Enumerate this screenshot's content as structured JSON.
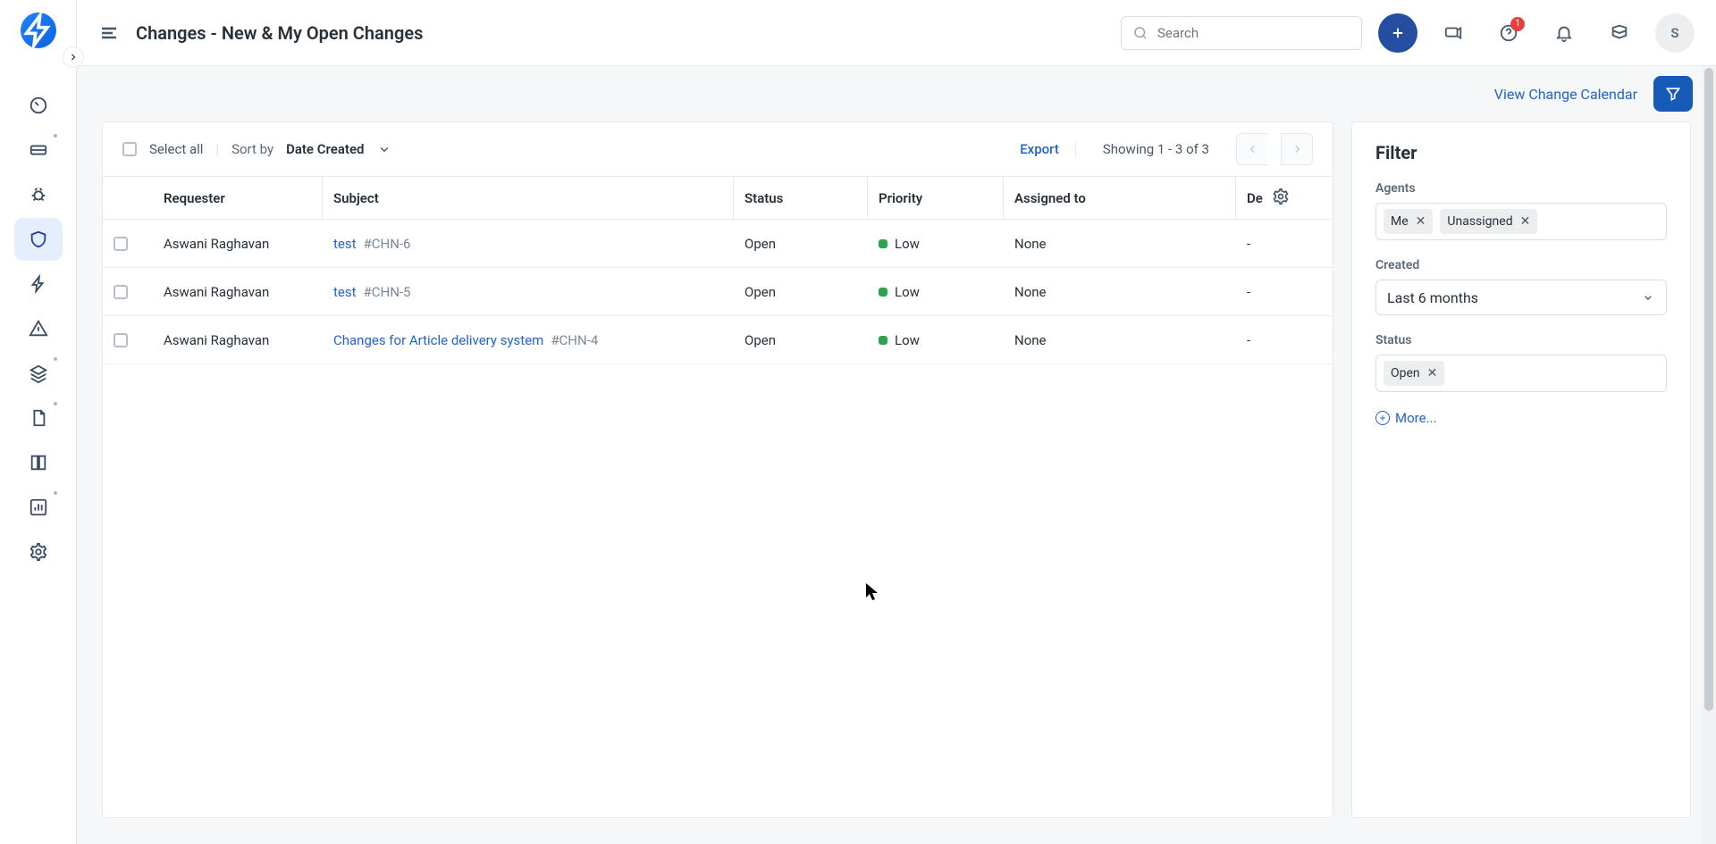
{
  "header": {
    "page_title": "Changes - New & My Open Changes",
    "search_placeholder": "Search",
    "notification_badge": "1",
    "avatar_initial": "S"
  },
  "sub_header": {
    "calendar_link": "View Change Calendar"
  },
  "toolbar": {
    "select_all_label": "Select all",
    "sort_by_label": "Sort by",
    "sort_value": "Date Created",
    "export_label": "Export",
    "pagination_info": "Showing 1 - 3 of 3"
  },
  "columns": {
    "requester": "Requester",
    "subject": "Subject",
    "status": "Status",
    "priority": "Priority",
    "assigned_to": "Assigned to",
    "last_truncated": "De"
  },
  "rows": [
    {
      "requester": "Aswani Raghavan",
      "subject": "test",
      "id": "#CHN-6",
      "status": "Open",
      "priority": "Low",
      "assigned_to": "None",
      "last": "-"
    },
    {
      "requester": "Aswani Raghavan",
      "subject": "test",
      "id": "#CHN-5",
      "status": "Open",
      "priority": "Low",
      "assigned_to": "None",
      "last": "-"
    },
    {
      "requester": "Aswani Raghavan",
      "subject": "Changes for Article delivery system",
      "id": "#CHN-4",
      "status": "Open",
      "priority": "Low",
      "assigned_to": "None",
      "last": "-"
    }
  ],
  "filter": {
    "title": "Filter",
    "agents_label": "Agents",
    "agents_chips": [
      "Me",
      "Unassigned"
    ],
    "created_label": "Created",
    "created_value": "Last 6 months",
    "status_label": "Status",
    "status_chips": [
      "Open"
    ],
    "more_label": "More..."
  }
}
